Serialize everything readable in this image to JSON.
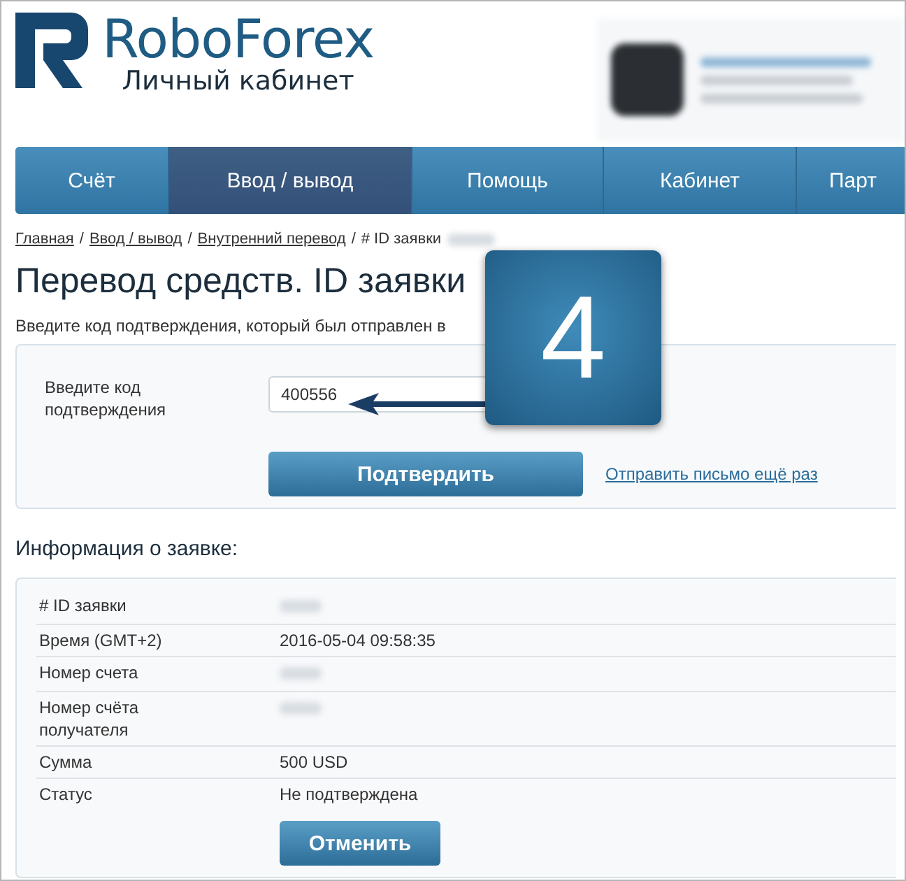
{
  "logo": {
    "name": "RoboForex",
    "subtitle": "Личный кабинет"
  },
  "banner": {
    "blurred": true
  },
  "nav": [
    {
      "label": "Счёт",
      "selected": false
    },
    {
      "label": "Ввод / вывод",
      "selected": true
    },
    {
      "label": "Помощь",
      "selected": false
    },
    {
      "label": "Кабинет",
      "selected": false
    },
    {
      "label": "Парт",
      "selected": false
    }
  ],
  "breadcrumb_separator": "/",
  "breadcrumbs": [
    {
      "label": "Главная",
      "link": true
    },
    {
      "label": "Ввод / вывод",
      "link": true
    },
    {
      "label": "Внутренний перевод",
      "link": true
    },
    {
      "label": "# ID заявки",
      "link": false,
      "blurred_id": true
    }
  ],
  "title": "Перевод средств. ID заявки",
  "description": "Введите код подтверждения, который был отправлен в",
  "code_form": {
    "label": "Введите код подтверждения",
    "value": "400556",
    "submit": "Подтвердить",
    "resend": "Отправить письмо ещё раз"
  },
  "step_badge": "4",
  "info": {
    "heading": "Информация о заявке:",
    "rows": [
      {
        "label": "# ID заявки",
        "blurred": true
      },
      {
        "label": "Время (GMT+2)",
        "value": "2016-05-04 09:58:35",
        "blurred": false
      },
      {
        "label": "Номер счета",
        "blurred": true
      },
      {
        "label": "Номер счёта получателя",
        "blurred": true
      },
      {
        "label": "Сумма",
        "value": "500 USD",
        "blurred": false
      },
      {
        "label": "Статус",
        "value": "Не подтверждена",
        "blurred": false
      }
    ],
    "cancel": "Отменить"
  }
}
